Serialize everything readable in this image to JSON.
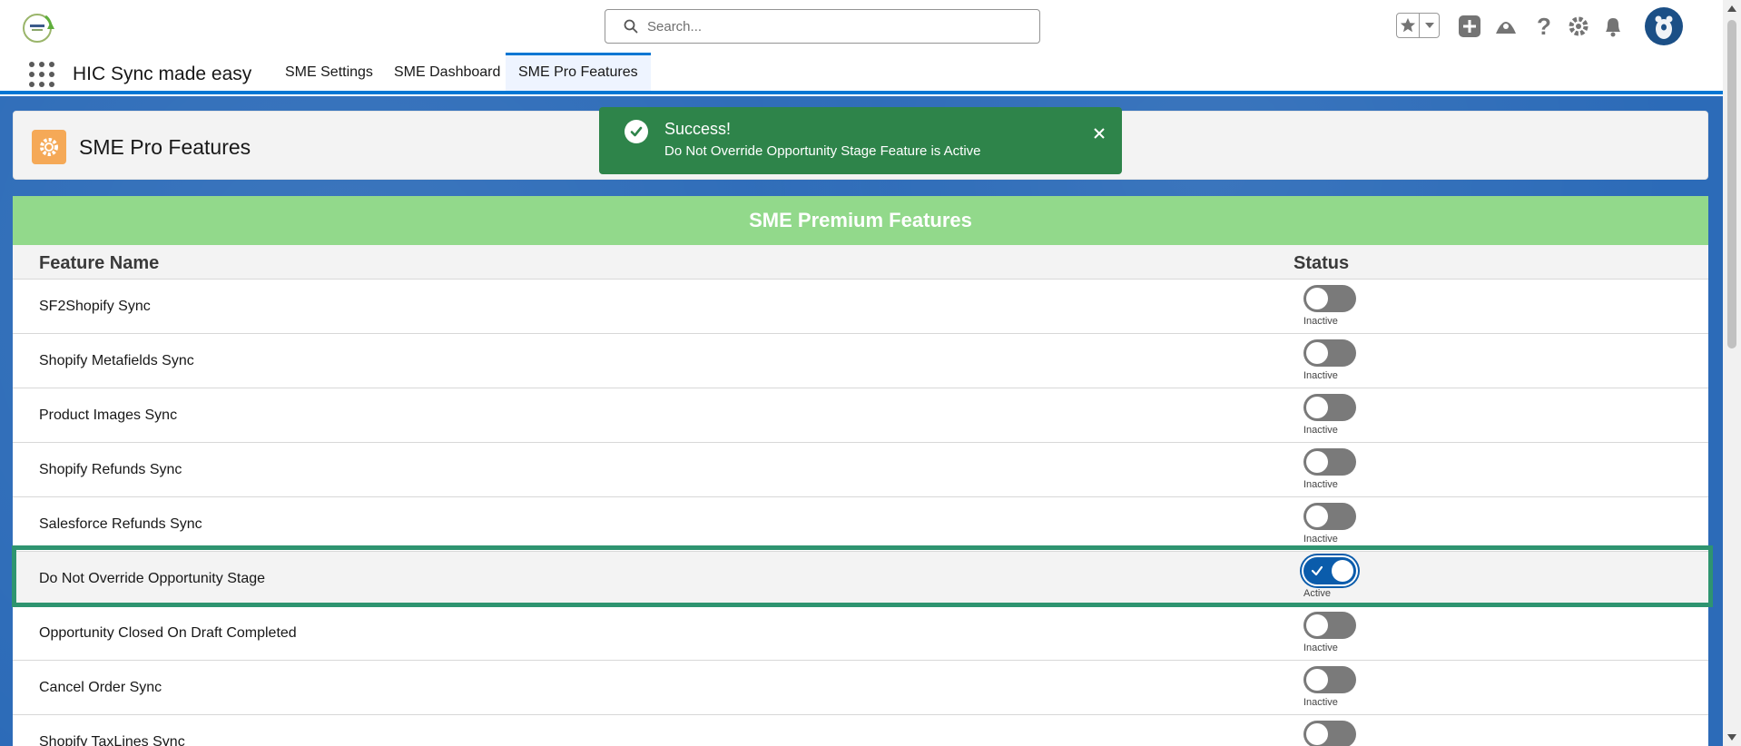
{
  "header": {
    "search_placeholder": "Search...",
    "icons": [
      "favorites-star-icon",
      "favorites-dropdown-icon",
      "global-actions-plus-icon",
      "trailhead-icon",
      "help-icon",
      "setup-gear-icon",
      "notifications-bell-icon",
      "user-avatar"
    ]
  },
  "app_nav": {
    "app_name": "HIC Sync made easy",
    "tabs": [
      {
        "label": "SME Settings",
        "active": false
      },
      {
        "label": "SME Dashboard",
        "active": false
      },
      {
        "label": "SME Pro Features",
        "active": true
      }
    ]
  },
  "page_header": {
    "title": "SME Pro Features",
    "icon": "gear-icon"
  },
  "toast": {
    "title": "Success!",
    "message": "Do Not Override Opportunity Stage Feature is Active",
    "icon": "success-check-icon"
  },
  "card": {
    "banner": "SME Premium Features",
    "col_name": "Feature Name",
    "col_status": "Status",
    "rows": [
      {
        "name": "SF2Shopify Sync",
        "status": "Inactive",
        "active": false
      },
      {
        "name": "Shopify Metafields Sync",
        "status": "Inactive",
        "active": false
      },
      {
        "name": "Product Images Sync",
        "status": "Inactive",
        "active": false
      },
      {
        "name": "Shopify Refunds Sync",
        "status": "Inactive",
        "active": false
      },
      {
        "name": "Salesforce Refunds Sync",
        "status": "Inactive",
        "active": false
      },
      {
        "name": "Do Not Override Opportunity Stage",
        "status": "Active",
        "active": true
      },
      {
        "name": "Opportunity Closed On Draft Completed",
        "status": "Inactive",
        "active": false
      },
      {
        "name": "Cancel Order Sync",
        "status": "Inactive",
        "active": false
      },
      {
        "name": "Shopify TaxLines Sync",
        "status": "",
        "active": false
      }
    ]
  },
  "colors": {
    "brand_blue": "#0176d3",
    "banner_green": "#92d98b",
    "toast_green": "#2e844a",
    "highlight_green": "#2e9470",
    "toggle_on": "#0b5cab",
    "toggle_off": "#7a7a7a"
  }
}
